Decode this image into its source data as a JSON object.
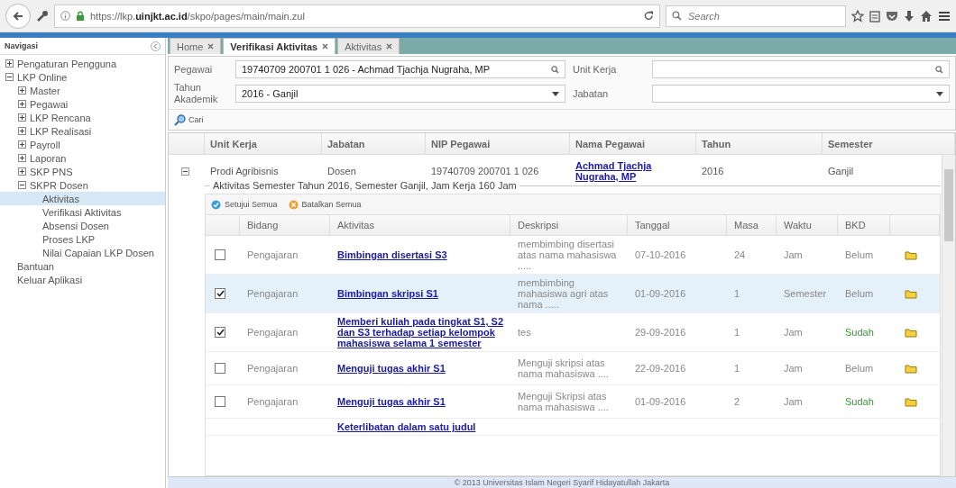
{
  "browser": {
    "url": "https://lkp.**uinjkt.ac.id**/skpo/pages/main/main.zul",
    "search": {
      "placeholder": "Search"
    }
  },
  "sidebar": {
    "title": "Navigasi",
    "items": [
      {
        "label": "Pengaturan Pengguna",
        "expanded": false,
        "selected": false
      },
      {
        "label": "LKP Online",
        "expanded": true,
        "selected": false,
        "children": [
          {
            "label": "Master",
            "expanded": false,
            "selected": false
          },
          {
            "label": "Pegawai",
            "expanded": false,
            "selected": false
          },
          {
            "label": "LKP Rencana",
            "expanded": false,
            "selected": false
          },
          {
            "label": "LKP Realisasi",
            "expanded": false,
            "selected": false
          },
          {
            "label": "Payroll",
            "expanded": false,
            "selected": false
          },
          {
            "label": "Laporan",
            "expanded": false,
            "selected": false
          },
          {
            "label": "SKP PNS",
            "expanded": false,
            "selected": false
          },
          {
            "label": "SKPR Dosen",
            "expanded": true,
            "selected": false,
            "children": [
              {
                "label": "Aktivitas",
                "selected": true
              },
              {
                "label": "Verifikasi Aktivitas",
                "selected": false
              },
              {
                "label": "Absensi Dosen",
                "selected": false
              },
              {
                "label": "Proses LKP",
                "selected": false
              },
              {
                "label": "Nilai Capaian LKP Dosen",
                "selected": false
              }
            ]
          }
        ]
      },
      {
        "label": "Bantuan",
        "selected": false
      },
      {
        "label": "Keluar Aplikasi",
        "selected": false
      }
    ]
  },
  "tabs": [
    {
      "label": "Home",
      "selected": false
    },
    {
      "label": "Verifikasi Aktivitas",
      "selected": true
    },
    {
      "label": "Aktivitas",
      "selected": false
    }
  ],
  "form": {
    "fields": [
      {
        "label": "Pegawai",
        "value": "19740709 200701 1 026 - Achmad Tjachja Nugraha, MP",
        "kind": "search"
      },
      {
        "label": "Unit Kerja",
        "kind": "search"
      },
      {
        "label": "Tahun Akademik",
        "value": "2016 - Ganjil",
        "kind": "dropdown"
      },
      {
        "label": "Jabatan",
        "kind": "dropdown"
      }
    ],
    "search_button": "Cari"
  },
  "master_table": {
    "columns": [
      "Unit Kerja",
      "Jabatan",
      "NIP Pegawai",
      "Nama Pegawai",
      "Tahun",
      "Semester"
    ],
    "rows": [
      {
        "expanded": true,
        "unit_kerja": "Prodi Agribisnis",
        "jabatan": "Dosen",
        "nip": "19740709 200701 1 026",
        "nama": "Achmad Tjachja Nugraha, MP",
        "tahun": "2016",
        "semester": "Ganjil"
      }
    ]
  },
  "detail": {
    "title": "Aktivitas Semester Tahun 2016, Semester Ganjil, Jam Kerja 160 Jam",
    "buttons": [
      "Setujui Semua",
      "Batalkan Semua"
    ],
    "columns": [
      "Bidang",
      "Aktivitas",
      "Deskripsi",
      "Tanggal",
      "Masa",
      "Waktu",
      "BKD"
    ],
    "rows": [
      {
        "checked": false,
        "selected": false,
        "bidang": "Pengajaran",
        "aktivitas": "Bimbingan disertasi S3",
        "deskripsi": "membimbing disertasi atas nama mahasiswa .....",
        "tanggal": "07-10-2016",
        "masa": "24",
        "waktu": "Jam",
        "bkd": "Belum",
        "approved": false
      },
      {
        "checked": true,
        "selected": true,
        "bidang": "Pengajaran",
        "aktivitas": "Bimbingan skripsi S1",
        "deskripsi": "membimbing mahasiswa agri atas nama .....",
        "tanggal": "01-09-2016",
        "masa": "1",
        "waktu": "Semester",
        "bkd": "Belum",
        "approved": false
      },
      {
        "checked": true,
        "selected": false,
        "bidang": "Pengajaran",
        "aktivitas": "Memberi kuliah pada tingkat S1, S2 dan S3 terhadap setiap kelompok mahasiswa selama 1 semester",
        "deskripsi": "tes",
        "tanggal": "29-09-2016",
        "masa": "1",
        "waktu": "Jam",
        "bkd": "Sudah",
        "approved": true
      },
      {
        "checked": false,
        "selected": false,
        "bidang": "Pengajaran",
        "aktivitas": "Menguji tugas akhir S1",
        "deskripsi": "Menguji skripsi atas nama mahasiswa ....",
        "tanggal": "22-09-2016",
        "masa": "1",
        "waktu": "Jam",
        "bkd": "Belum",
        "approved": false
      },
      {
        "checked": false,
        "selected": false,
        "bidang": "Pengajaran",
        "aktivitas": "Menguji tugas akhir S1",
        "deskripsi": "Menguji Skripsi atas nama mahasiswa ....",
        "tanggal": "01-09-2016",
        "masa": "2",
        "waktu": "Jam",
        "bkd": "Sudah",
        "approved": true
      },
      {
        "aktivitas": "Keterlibatan dalam satu judul"
      }
    ]
  },
  "footer": "© 2013 Universitas Islam Negeri Syarif Hidayatullah Jakarta"
}
